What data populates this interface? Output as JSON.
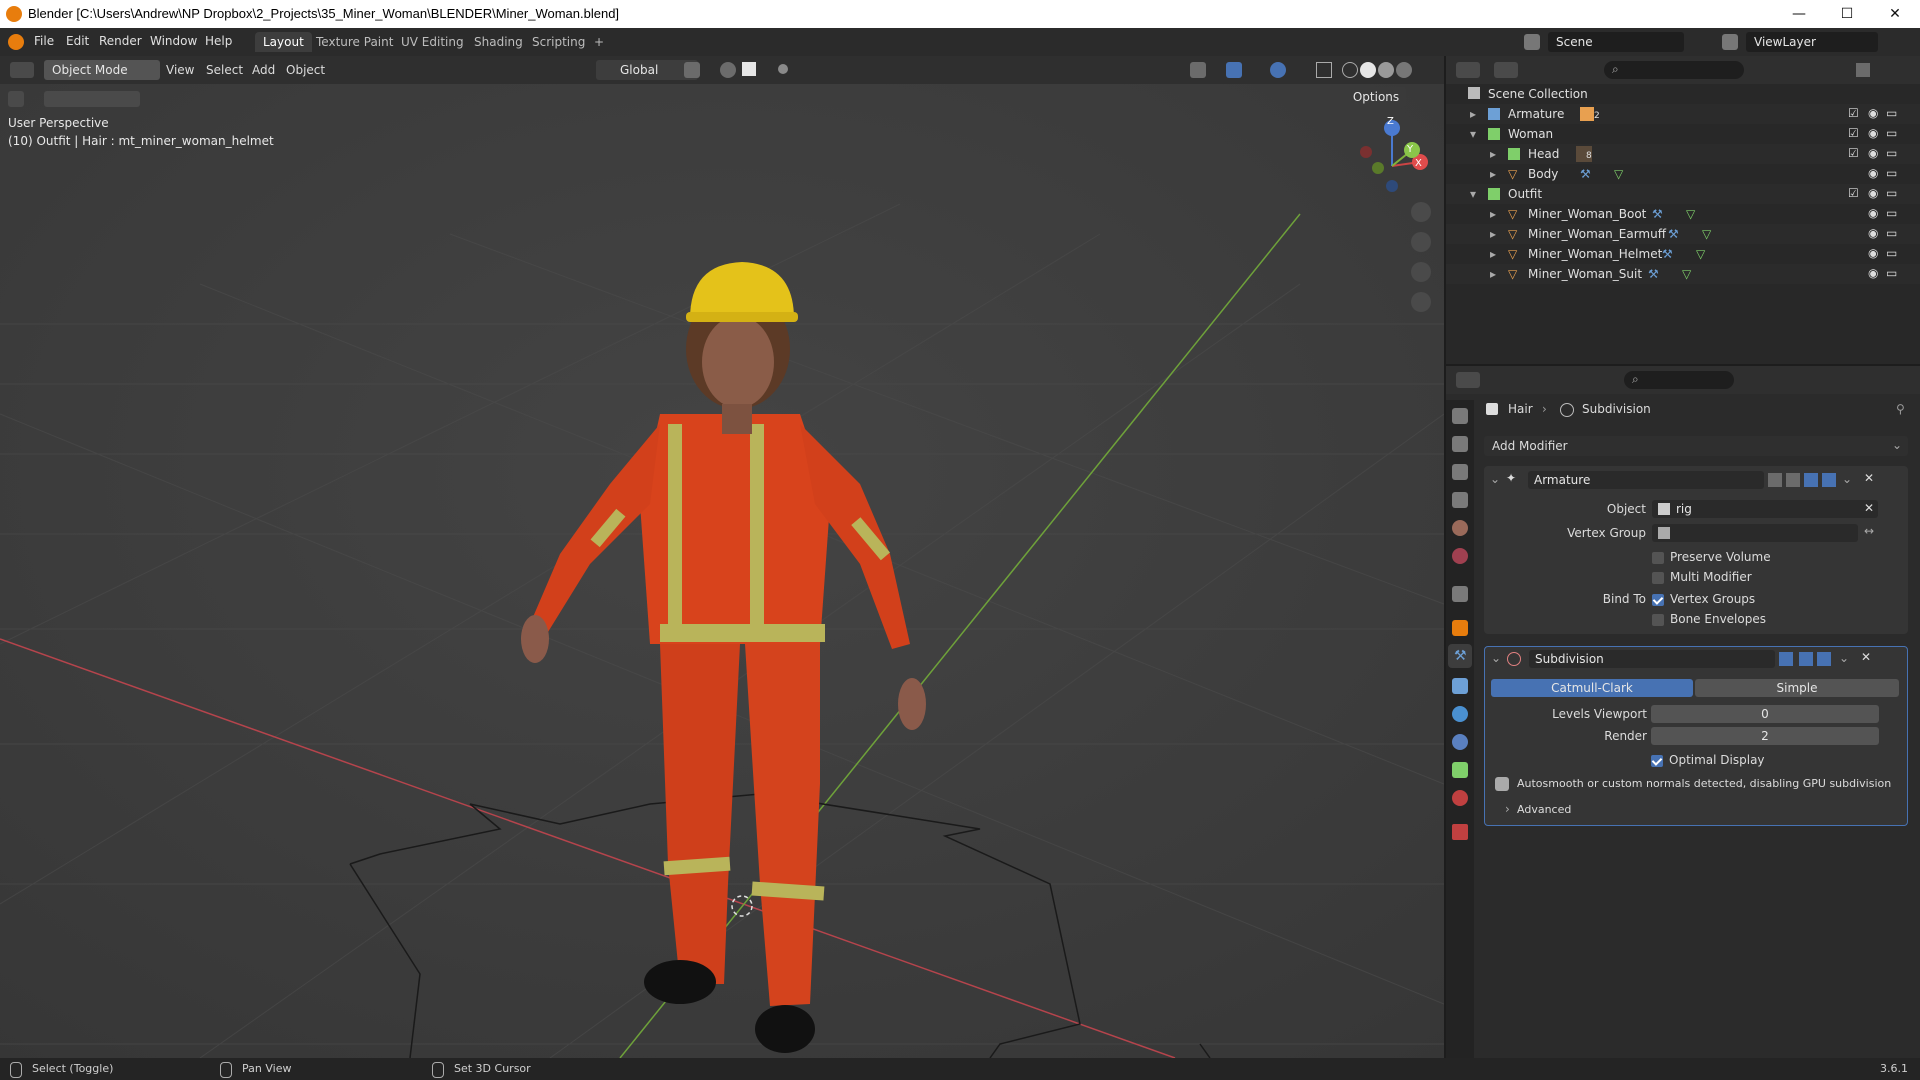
{
  "window": {
    "title": "Blender [C:\\Users\\Andrew\\NP Dropbox\\2_Projects\\35_Miner_Woman\\BLENDER\\Miner_Woman.blend]",
    "minimize": "—",
    "maximize": "☐",
    "close": "✕"
  },
  "menu": {
    "items": [
      "File",
      "Edit",
      "Render",
      "Window",
      "Help"
    ]
  },
  "workspaces": {
    "tabs": [
      "Layout",
      "Texture Paint",
      "UV Editing",
      "Shading",
      "Scripting"
    ],
    "add": "+"
  },
  "scene": {
    "name": "Scene",
    "view_layer": "ViewLayer"
  },
  "viewport_header": {
    "mode": "Object Mode",
    "view": "View",
    "select": "Select",
    "add": "Add",
    "object": "Object",
    "orientation": "Global",
    "options": "Options"
  },
  "viewport": {
    "perspective": "User Perspective",
    "selection_info": "(10) Outfit | Hair : mt_miner_woman_helmet",
    "gizmo": {
      "x": "X",
      "y": "Y",
      "z": "Z"
    }
  },
  "outliner": {
    "root": "Scene Collection",
    "items": [
      {
        "label": "Armature",
        "badge": "2"
      },
      {
        "label": "Woman"
      },
      {
        "label": "Head",
        "badge": "8"
      },
      {
        "label": "Body"
      },
      {
        "label": "Outfit"
      },
      {
        "label": "Miner_Woman_Boot"
      },
      {
        "label": "Miner_Woman_Earmuff"
      },
      {
        "label": "Miner_Woman_Helmet"
      },
      {
        "label": "Miner_Woman_Suit"
      }
    ]
  },
  "properties": {
    "breadcrumb": {
      "object": "Hair",
      "modifier": "Subdivision"
    },
    "add_modifier": "Add Modifier",
    "armature": {
      "name": "Armature",
      "object_label": "Object",
      "object_value": "rig",
      "vertex_group_label": "Vertex Group",
      "preserve_volume": "Preserve Volume",
      "multi_modifier": "Multi Modifier",
      "bind_to_label": "Bind To",
      "vertex_groups": "Vertex Groups",
      "bone_envelopes": "Bone Envelopes"
    },
    "subdivision": {
      "name": "Subdivision",
      "catmull_clark": "Catmull-Clark",
      "simple": "Simple",
      "levels_viewport_label": "Levels Viewport",
      "levels_viewport_value": "0",
      "render_label": "Render",
      "render_value": "2",
      "optimal_display": "Optimal Display",
      "warning": "Autosmooth or custom normals detected, disabling GPU subdivision",
      "advanced": "Advanced"
    }
  },
  "statusbar": {
    "select": "Select (Toggle)",
    "pan": "Pan View",
    "cursor": "Set 3D Cursor",
    "version": "3.6.1"
  },
  "colors": {
    "accent": "#4772b3",
    "orange": "#e87d0d",
    "suit": "#d8431c",
    "helmet": "#e4c21a"
  }
}
